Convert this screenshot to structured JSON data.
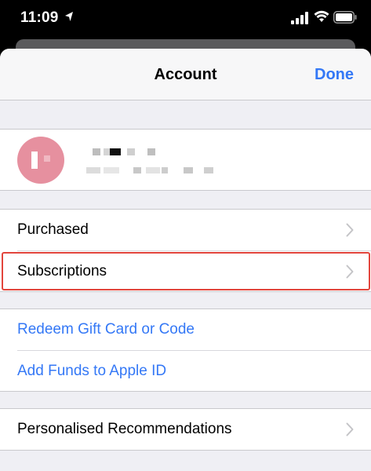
{
  "status_bar": {
    "time": "11:09",
    "icons": [
      "location-arrow-icon",
      "cellular-signal-icon",
      "wifi-icon",
      "battery-icon"
    ]
  },
  "nav": {
    "title": "Account",
    "done_label": "Done"
  },
  "profile": {
    "name": "",
    "email": "",
    "avatar_color": "#e6909f"
  },
  "groups": {
    "library": [
      {
        "label": "Purchased",
        "icon": "chevron-right-icon"
      },
      {
        "label": "Subscriptions",
        "icon": "chevron-right-icon"
      }
    ],
    "funds": [
      {
        "label": "Redeem Gift Card or Code"
      },
      {
        "label": "Add Funds to Apple ID"
      }
    ],
    "settings": [
      {
        "label": "Personalised Recommendations",
        "icon": "chevron-right-icon"
      }
    ]
  },
  "colors": {
    "accent": "#3478f6",
    "highlight": "#e2453c",
    "background": "#efeff4"
  }
}
